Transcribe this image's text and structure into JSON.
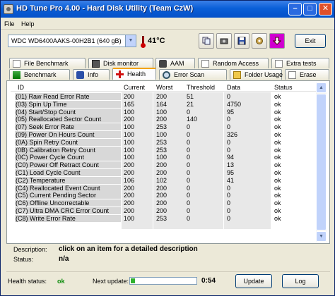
{
  "window": {
    "title": "HD Tune Pro 4.00 - Hard Disk Utility (Team CzW)"
  },
  "menu": {
    "file": "File",
    "help": "Help"
  },
  "toolbar": {
    "drive": "WDC WD6400AAKS-00H2B1 (640 gB)",
    "temperature": "41°C",
    "exit_label": "Exit"
  },
  "tabs_top": [
    {
      "label": "File Benchmark",
      "icon": "file-benchmark-icon"
    },
    {
      "label": "Disk monitor",
      "icon": "disk-monitor-icon"
    },
    {
      "label": "AAM",
      "icon": "speaker-icon"
    },
    {
      "label": "Random Access",
      "icon": "random-access-icon"
    },
    {
      "label": "Extra tests",
      "icon": "extra-tests-icon"
    }
  ],
  "tabs_bottom": [
    {
      "label": "Benchmark",
      "icon": "benchmark-icon"
    },
    {
      "label": "Info",
      "icon": "info-icon"
    },
    {
      "label": "Health",
      "icon": "health-cross-icon",
      "active": true
    },
    {
      "label": "Error Scan",
      "icon": "magnifier-icon"
    },
    {
      "label": "Folder Usage",
      "icon": "folder-icon"
    },
    {
      "label": "Erase",
      "icon": "erase-icon"
    }
  ],
  "table": {
    "headers": {
      "id": "ID",
      "current": "Current",
      "worst": "Worst",
      "threshold": "Threshold",
      "data": "Data",
      "status": "Status"
    },
    "rows": [
      {
        "id": "(01) Raw Read Error Rate",
        "current": "200",
        "worst": "200",
        "threshold": "51",
        "data": "0",
        "status": "ok"
      },
      {
        "id": "(03) Spin Up Time",
        "current": "165",
        "worst": "164",
        "threshold": "21",
        "data": "4750",
        "status": "ok"
      },
      {
        "id": "(04) Start/Stop Count",
        "current": "100",
        "worst": "100",
        "threshold": "0",
        "data": "95",
        "status": "ok"
      },
      {
        "id": "(05) Reallocated Sector Count",
        "current": "200",
        "worst": "200",
        "threshold": "140",
        "data": "0",
        "status": "ok"
      },
      {
        "id": "(07) Seek Error Rate",
        "current": "100",
        "worst": "253",
        "threshold": "0",
        "data": "0",
        "status": "ok"
      },
      {
        "id": "(09) Power On Hours Count",
        "current": "100",
        "worst": "100",
        "threshold": "0",
        "data": "326",
        "status": "ok"
      },
      {
        "id": "(0A) Spin Retry Count",
        "current": "100",
        "worst": "253",
        "threshold": "0",
        "data": "0",
        "status": "ok"
      },
      {
        "id": "(0B) Calibration Retry Count",
        "current": "100",
        "worst": "253",
        "threshold": "0",
        "data": "0",
        "status": "ok"
      },
      {
        "id": "(0C) Power Cycle Count",
        "current": "100",
        "worst": "100",
        "threshold": "0",
        "data": "94",
        "status": "ok"
      },
      {
        "id": "(C0) Power Off Retract Count",
        "current": "200",
        "worst": "200",
        "threshold": "0",
        "data": "13",
        "status": "ok"
      },
      {
        "id": "(C1) Load Cycle Count",
        "current": "200",
        "worst": "200",
        "threshold": "0",
        "data": "95",
        "status": "ok"
      },
      {
        "id": "(C2) Temperature",
        "current": "106",
        "worst": "102",
        "threshold": "0",
        "data": "41",
        "status": "ok"
      },
      {
        "id": "(C4) Reallocated Event Count",
        "current": "200",
        "worst": "200",
        "threshold": "0",
        "data": "0",
        "status": "ok"
      },
      {
        "id": "(C5) Current Pending Sector",
        "current": "200",
        "worst": "200",
        "threshold": "0",
        "data": "0",
        "status": "ok"
      },
      {
        "id": "(C6) Offline Uncorrectable",
        "current": "200",
        "worst": "200",
        "threshold": "0",
        "data": "0",
        "status": "ok"
      },
      {
        "id": "(C7) Ultra DMA CRC Error Count",
        "current": "200",
        "worst": "200",
        "threshold": "0",
        "data": "0",
        "status": "ok"
      },
      {
        "id": "(C8) Write Error Rate",
        "current": "100",
        "worst": "253",
        "threshold": "0",
        "data": "0",
        "status": "ok"
      }
    ]
  },
  "details": {
    "description_label": "Description:",
    "description_value": "click on an item for a detailed description",
    "status_label": "Status:",
    "status_value": "n/a"
  },
  "footer": {
    "health_label": "Health status:",
    "health_value": "ok",
    "next_update_label": "Next update:",
    "countdown": "0:54",
    "progress_fraction": 0.08,
    "update_label": "Update",
    "log_label": "Log"
  },
  "colors": {
    "title_bar": "#0a5fd8",
    "health_ok": "#0a8a0a",
    "active_tab_accent": "#f3a314"
  }
}
